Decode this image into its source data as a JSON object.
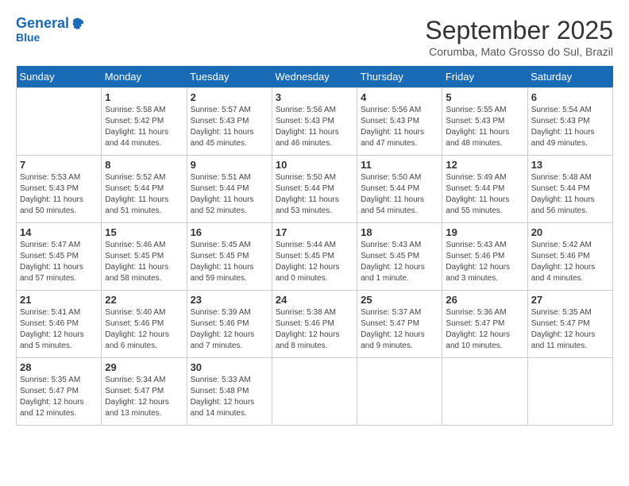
{
  "header": {
    "logo_line1": "General",
    "logo_line2": "Blue",
    "month_title": "September 2025",
    "location": "Corumba, Mato Grosso do Sul, Brazil"
  },
  "calendar": {
    "days_of_week": [
      "Sunday",
      "Monday",
      "Tuesday",
      "Wednesday",
      "Thursday",
      "Friday",
      "Saturday"
    ],
    "weeks": [
      [
        {
          "day": "",
          "info": ""
        },
        {
          "day": "1",
          "info": "Sunrise: 5:58 AM\nSunset: 5:42 PM\nDaylight: 11 hours\nand 44 minutes."
        },
        {
          "day": "2",
          "info": "Sunrise: 5:57 AM\nSunset: 5:43 PM\nDaylight: 11 hours\nand 45 minutes."
        },
        {
          "day": "3",
          "info": "Sunrise: 5:56 AM\nSunset: 5:43 PM\nDaylight: 11 hours\nand 46 minutes."
        },
        {
          "day": "4",
          "info": "Sunrise: 5:56 AM\nSunset: 5:43 PM\nDaylight: 11 hours\nand 47 minutes."
        },
        {
          "day": "5",
          "info": "Sunrise: 5:55 AM\nSunset: 5:43 PM\nDaylight: 11 hours\nand 48 minutes."
        },
        {
          "day": "6",
          "info": "Sunrise: 5:54 AM\nSunset: 5:43 PM\nDaylight: 11 hours\nand 49 minutes."
        }
      ],
      [
        {
          "day": "7",
          "info": "Sunrise: 5:53 AM\nSunset: 5:43 PM\nDaylight: 11 hours\nand 50 minutes."
        },
        {
          "day": "8",
          "info": "Sunrise: 5:52 AM\nSunset: 5:44 PM\nDaylight: 11 hours\nand 51 minutes."
        },
        {
          "day": "9",
          "info": "Sunrise: 5:51 AM\nSunset: 5:44 PM\nDaylight: 11 hours\nand 52 minutes."
        },
        {
          "day": "10",
          "info": "Sunrise: 5:50 AM\nSunset: 5:44 PM\nDaylight: 11 hours\nand 53 minutes."
        },
        {
          "day": "11",
          "info": "Sunrise: 5:50 AM\nSunset: 5:44 PM\nDaylight: 11 hours\nand 54 minutes."
        },
        {
          "day": "12",
          "info": "Sunrise: 5:49 AM\nSunset: 5:44 PM\nDaylight: 11 hours\nand 55 minutes."
        },
        {
          "day": "13",
          "info": "Sunrise: 5:48 AM\nSunset: 5:44 PM\nDaylight: 11 hours\nand 56 minutes."
        }
      ],
      [
        {
          "day": "14",
          "info": "Sunrise: 5:47 AM\nSunset: 5:45 PM\nDaylight: 11 hours\nand 57 minutes."
        },
        {
          "day": "15",
          "info": "Sunrise: 5:46 AM\nSunset: 5:45 PM\nDaylight: 11 hours\nand 58 minutes."
        },
        {
          "day": "16",
          "info": "Sunrise: 5:45 AM\nSunset: 5:45 PM\nDaylight: 11 hours\nand 59 minutes."
        },
        {
          "day": "17",
          "info": "Sunrise: 5:44 AM\nSunset: 5:45 PM\nDaylight: 12 hours\nand 0 minutes."
        },
        {
          "day": "18",
          "info": "Sunrise: 5:43 AM\nSunset: 5:45 PM\nDaylight: 12 hours\nand 1 minute."
        },
        {
          "day": "19",
          "info": "Sunrise: 5:43 AM\nSunset: 5:46 PM\nDaylight: 12 hours\nand 3 minutes."
        },
        {
          "day": "20",
          "info": "Sunrise: 5:42 AM\nSunset: 5:46 PM\nDaylight: 12 hours\nand 4 minutes."
        }
      ],
      [
        {
          "day": "21",
          "info": "Sunrise: 5:41 AM\nSunset: 5:46 PM\nDaylight: 12 hours\nand 5 minutes."
        },
        {
          "day": "22",
          "info": "Sunrise: 5:40 AM\nSunset: 5:46 PM\nDaylight: 12 hours\nand 6 minutes."
        },
        {
          "day": "23",
          "info": "Sunrise: 5:39 AM\nSunset: 5:46 PM\nDaylight: 12 hours\nand 7 minutes."
        },
        {
          "day": "24",
          "info": "Sunrise: 5:38 AM\nSunset: 5:46 PM\nDaylight: 12 hours\nand 8 minutes."
        },
        {
          "day": "25",
          "info": "Sunrise: 5:37 AM\nSunset: 5:47 PM\nDaylight: 12 hours\nand 9 minutes."
        },
        {
          "day": "26",
          "info": "Sunrise: 5:36 AM\nSunset: 5:47 PM\nDaylight: 12 hours\nand 10 minutes."
        },
        {
          "day": "27",
          "info": "Sunrise: 5:35 AM\nSunset: 5:47 PM\nDaylight: 12 hours\nand 11 minutes."
        }
      ],
      [
        {
          "day": "28",
          "info": "Sunrise: 5:35 AM\nSunset: 5:47 PM\nDaylight: 12 hours\nand 12 minutes."
        },
        {
          "day": "29",
          "info": "Sunrise: 5:34 AM\nSunset: 5:47 PM\nDaylight: 12 hours\nand 13 minutes."
        },
        {
          "day": "30",
          "info": "Sunrise: 5:33 AM\nSunset: 5:48 PM\nDaylight: 12 hours\nand 14 minutes."
        },
        {
          "day": "",
          "info": ""
        },
        {
          "day": "",
          "info": ""
        },
        {
          "day": "",
          "info": ""
        },
        {
          "day": "",
          "info": ""
        }
      ]
    ]
  }
}
